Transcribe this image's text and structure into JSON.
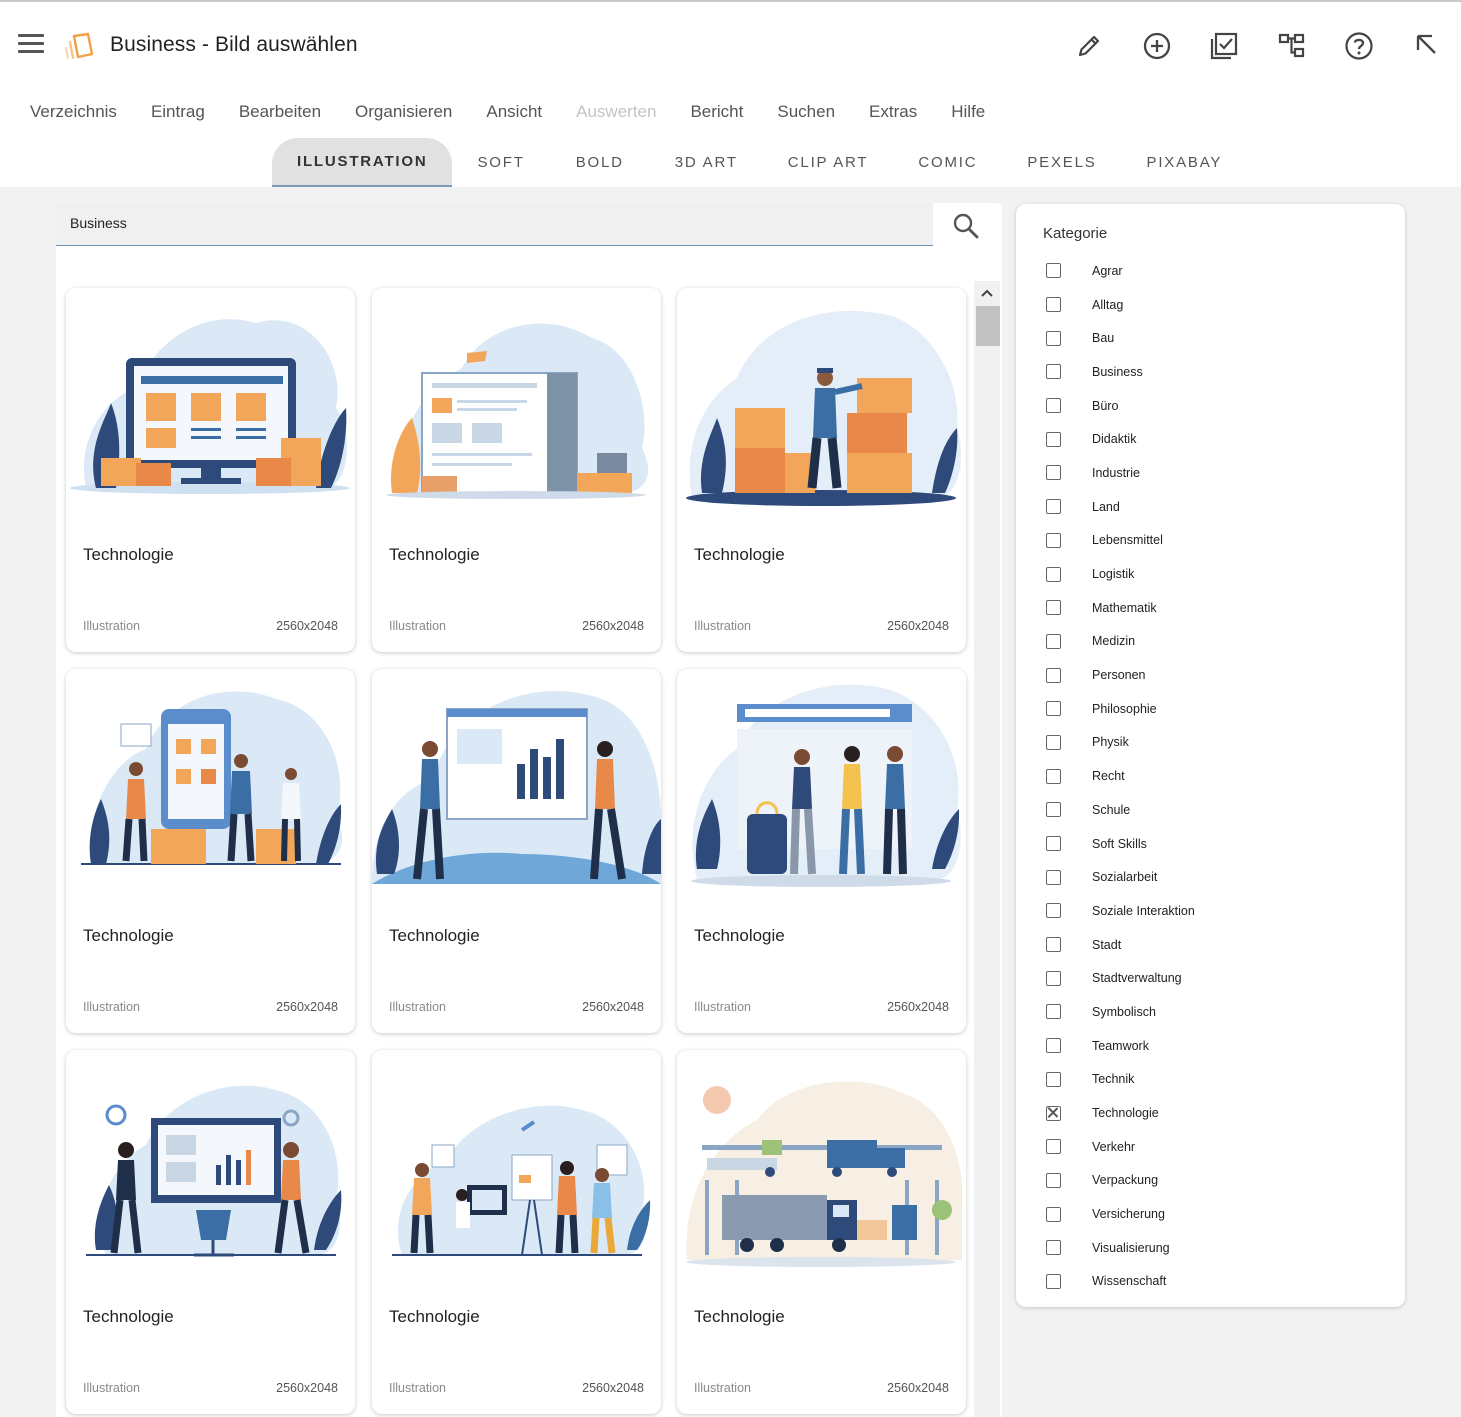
{
  "app": {
    "title": "Business - Bild auswählen"
  },
  "toolbar": {
    "icons": [
      "pencil-icon",
      "plus-circle-icon",
      "checklist-icon",
      "tree-icon",
      "help-icon",
      "arrow-up-left-icon"
    ]
  },
  "main_menu": [
    {
      "label": "Verzeichnis",
      "disabled": false
    },
    {
      "label": "Eintrag",
      "disabled": false
    },
    {
      "label": "Bearbeiten",
      "disabled": false
    },
    {
      "label": "Organisieren",
      "disabled": false
    },
    {
      "label": "Ansicht",
      "disabled": false
    },
    {
      "label": "Auswerten",
      "disabled": true
    },
    {
      "label": "Bericht",
      "disabled": false
    },
    {
      "label": "Suchen",
      "disabled": false
    },
    {
      "label": "Extras",
      "disabled": false
    },
    {
      "label": "Hilfe",
      "disabled": false
    }
  ],
  "style_tabs": [
    {
      "label": "ILLUSTRATION",
      "active": true
    },
    {
      "label": "SOFT",
      "active": false
    },
    {
      "label": "BOLD",
      "active": false
    },
    {
      "label": "3D ART",
      "active": false
    },
    {
      "label": "CLIP ART",
      "active": false
    },
    {
      "label": "COMIC",
      "active": false
    },
    {
      "label": "PEXELS",
      "active": false
    },
    {
      "label": "PIXABAY",
      "active": false
    }
  ],
  "search": {
    "value": "Business"
  },
  "cards": [
    {
      "title": "Technologie",
      "type": "Illustration",
      "size": "2560x2048",
      "scene": "monitor-shop"
    },
    {
      "title": "Technologie",
      "type": "Illustration",
      "size": "2560x2048",
      "scene": "catalog"
    },
    {
      "title": "Technologie",
      "type": "Illustration",
      "size": "2560x2048",
      "scene": "boxes-worker"
    },
    {
      "title": "Technologie",
      "type": "Illustration",
      "size": "2560x2048",
      "scene": "phone-shop"
    },
    {
      "title": "Technologie",
      "type": "Illustration",
      "size": "2560x2048",
      "scene": "presentation"
    },
    {
      "title": "Technologie",
      "type": "Illustration",
      "size": "2560x2048",
      "scene": "handshake"
    },
    {
      "title": "Technologie",
      "type": "Illustration",
      "size": "2560x2048",
      "scene": "dashboard"
    },
    {
      "title": "Technologie",
      "type": "Illustration",
      "size": "2560x2048",
      "scene": "office-team"
    },
    {
      "title": "Technologie",
      "type": "Illustration",
      "size": "2560x2048",
      "scene": "logistics"
    }
  ],
  "categories": {
    "heading": "Kategorie",
    "items": [
      {
        "label": "Agrar",
        "checked": false
      },
      {
        "label": "Alltag",
        "checked": false
      },
      {
        "label": "Bau",
        "checked": false
      },
      {
        "label": "Business",
        "checked": false
      },
      {
        "label": "Büro",
        "checked": false
      },
      {
        "label": "Didaktik",
        "checked": false
      },
      {
        "label": "Industrie",
        "checked": false
      },
      {
        "label": "Land",
        "checked": false
      },
      {
        "label": "Lebensmittel",
        "checked": false
      },
      {
        "label": "Logistik",
        "checked": false
      },
      {
        "label": "Mathematik",
        "checked": false
      },
      {
        "label": "Medizin",
        "checked": false
      },
      {
        "label": "Personen",
        "checked": false
      },
      {
        "label": "Philosophie",
        "checked": false
      },
      {
        "label": "Physik",
        "checked": false
      },
      {
        "label": "Recht",
        "checked": false
      },
      {
        "label": "Schule",
        "checked": false
      },
      {
        "label": "Soft Skills",
        "checked": false
      },
      {
        "label": "Sozialarbeit",
        "checked": false
      },
      {
        "label": "Soziale Interaktion",
        "checked": false
      },
      {
        "label": "Stadt",
        "checked": false
      },
      {
        "label": "Stadtverwaltung",
        "checked": false
      },
      {
        "label": "Symbolisch",
        "checked": false
      },
      {
        "label": "Teamwork",
        "checked": false
      },
      {
        "label": "Technik",
        "checked": false
      },
      {
        "label": "Technologie",
        "checked": true
      },
      {
        "label": "Verkehr",
        "checked": false
      },
      {
        "label": "Verpackung",
        "checked": false
      },
      {
        "label": "Versicherung",
        "checked": false
      },
      {
        "label": "Visualisierung",
        "checked": false
      },
      {
        "label": "Wissenschaft",
        "checked": false
      }
    ]
  },
  "colors": {
    "accent": "#7d98b8",
    "illustration_blue": "#2e4a7a",
    "illustration_orange": "#f2a65a",
    "illustration_sky": "#dbe9f7"
  }
}
